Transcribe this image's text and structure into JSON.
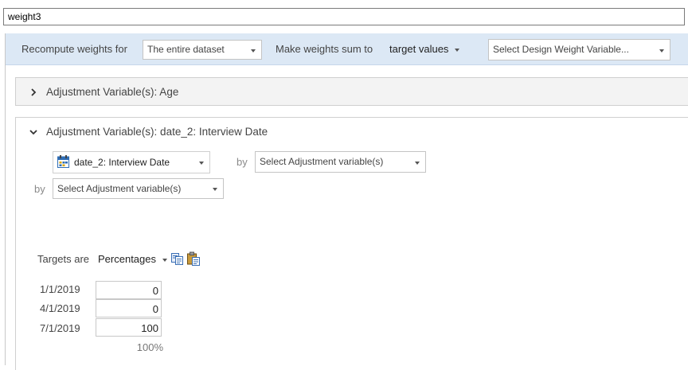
{
  "name_field": {
    "value": "weight3"
  },
  "toolbar": {
    "recompute_label": "Recompute weights for",
    "recompute_select": "The entire dataset",
    "sum_label": "Make weights sum to",
    "sum_value": "target values",
    "design_weight_placeholder": "Select Design Weight Variable..."
  },
  "panels": [
    {
      "title": "Adjustment Variable(s): Age",
      "expanded": false
    },
    {
      "title": "Adjustment Variable(s): date_2: Interview Date",
      "expanded": true,
      "var1": "date_2: Interview Date",
      "by_label": "by",
      "var2_placeholder": "Select Adjustment variable(s)",
      "var3_placeholder": "Select Adjustment variable(s)",
      "targets_label": "Targets are",
      "targets_type": "Percentages",
      "rows": [
        {
          "label": "1/1/2019",
          "value": "0"
        },
        {
          "label": "4/1/2019",
          "value": "0"
        },
        {
          "label": "7/1/2019",
          "value": "100"
        }
      ],
      "total": "100%"
    }
  ],
  "icons": {
    "copy": "copy-icon",
    "paste": "paste-icon",
    "calendar": "calendar-variable-icon",
    "chevron_right": "chevron-right-icon",
    "chevron_down": "chevron-down-icon"
  },
  "colors": {
    "toolbar_bg": "#dce8f5",
    "accent_blue": "#2f6db5"
  }
}
